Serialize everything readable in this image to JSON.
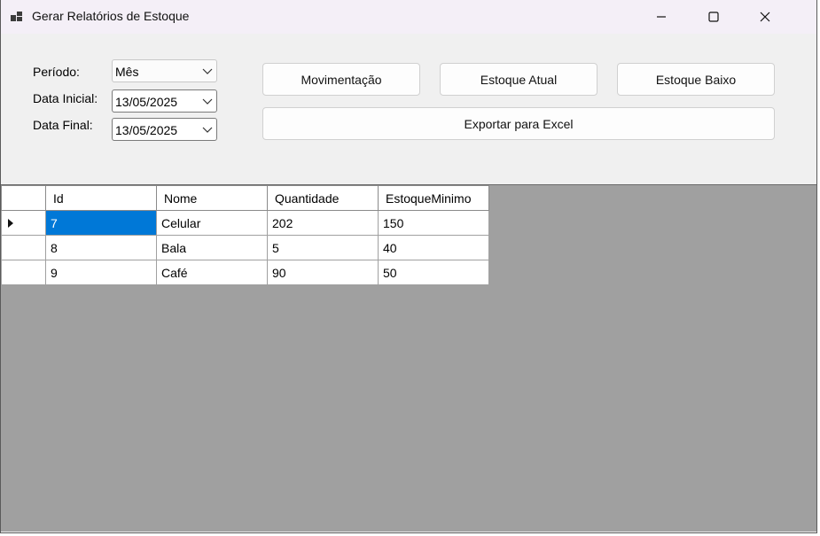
{
  "window": {
    "title": "Gerar Relatórios de Estoque"
  },
  "filters": {
    "periodo_label": "Período:",
    "periodo_value": "Mês",
    "data_inicial_label": "Data Inicial:",
    "data_inicial_value": "13/05/2025",
    "data_final_label": "Data Final:",
    "data_final_value": "13/05/2025"
  },
  "buttons": {
    "movimentacao": "Movimentação",
    "estoque_atual": "Estoque Atual",
    "estoque_baixo": "Estoque Baixo",
    "exportar": "Exportar para Excel"
  },
  "grid": {
    "columns": [
      "Id",
      "Nome",
      "Quantidade",
      "EstoqueMinimo"
    ],
    "rows": [
      [
        "7",
        "Celular",
        "202",
        "150"
      ],
      [
        "8",
        "Bala",
        "5",
        "40"
      ],
      [
        "9",
        "Café",
        "90",
        "50"
      ]
    ],
    "selected_row": 0
  },
  "icons": {
    "app": "app-window-icon",
    "minimize": "minimize-icon",
    "maximize": "maximize-icon",
    "close": "close-icon",
    "row_indicator": "current-row-arrow-icon",
    "dropdown": "chevron-down-icon"
  }
}
